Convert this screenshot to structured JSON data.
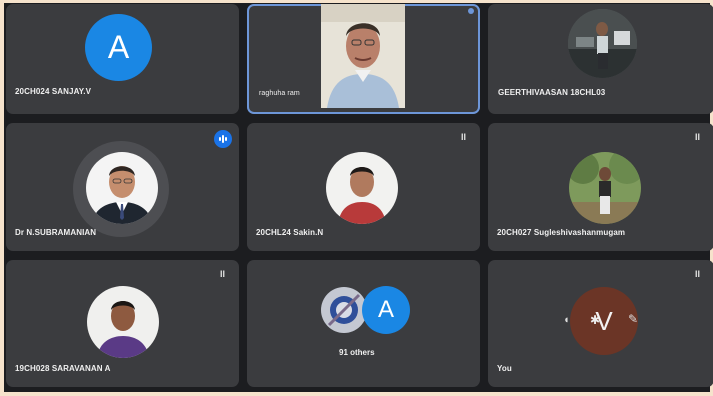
{
  "participants": [
    {
      "name": "20CH024 SANJAY.V",
      "avatar_letter": "A",
      "avatar_color": "#1a87e4"
    },
    {
      "name": "raghuha ram",
      "video": true
    },
    {
      "name": "GEERTHIVAASAN 18CHL03"
    },
    {
      "name": "Dr N.SUBRAMANIAN",
      "speaking": true
    },
    {
      "name": "20CHL24 Sakin.N"
    },
    {
      "name": "20CH027 Sugleshivashanmugam"
    },
    {
      "name": "19CH028 SARAVANAN A"
    },
    {
      "name": "91 others",
      "avatar_letter": "A"
    },
    {
      "name": "You",
      "self_avatar_letter": "V"
    }
  ],
  "colors": {
    "tile_bg": "#3b3c3f",
    "grid_bg": "#1c1d20",
    "accent_blue": "#1a73e8",
    "self_avatar": "#6b3526"
  },
  "icons": [
    "microphone-off-icon",
    "audio-wave-icon",
    "pin-icon",
    "edit-icon"
  ]
}
